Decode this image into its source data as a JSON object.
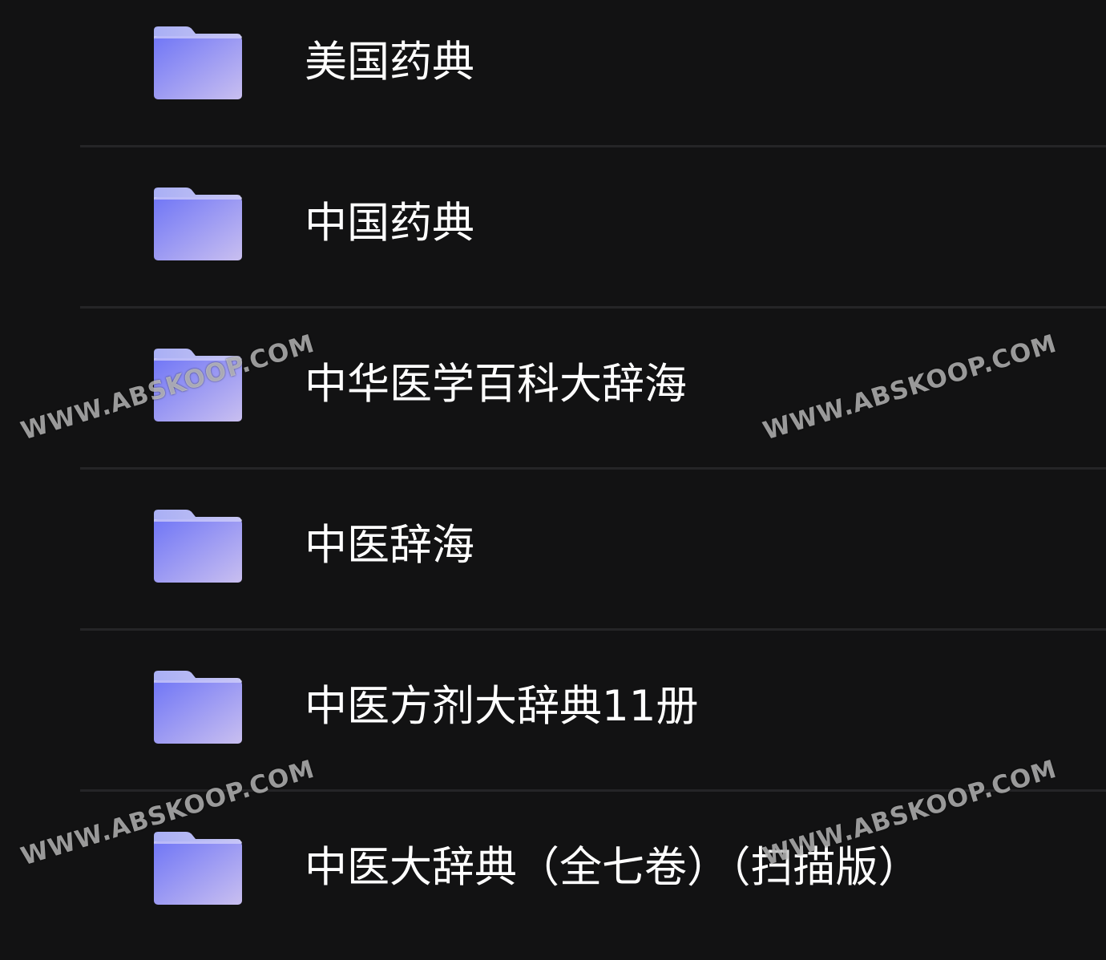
{
  "folders": [
    {
      "icon": "folder-icon",
      "name": "美国药典"
    },
    {
      "icon": "folder-icon",
      "name": "中国药典"
    },
    {
      "icon": "folder-icon",
      "name": "中华医学百科大辞海"
    },
    {
      "icon": "folder-icon",
      "name": "中医辞海"
    },
    {
      "icon": "folder-icon",
      "name": "中医方剂大辞典11册"
    },
    {
      "icon": "folder-icon",
      "name": "中医大辞典（全七卷）（扫描版）"
    }
  ],
  "watermark": {
    "text": "WWW.ABSKOOP.COM"
  },
  "colors": {
    "background": "#121213",
    "divider": "#252527",
    "text": "#ffffff",
    "folder_light": "#b9b8f2",
    "folder_dark": "#7b83f6"
  }
}
